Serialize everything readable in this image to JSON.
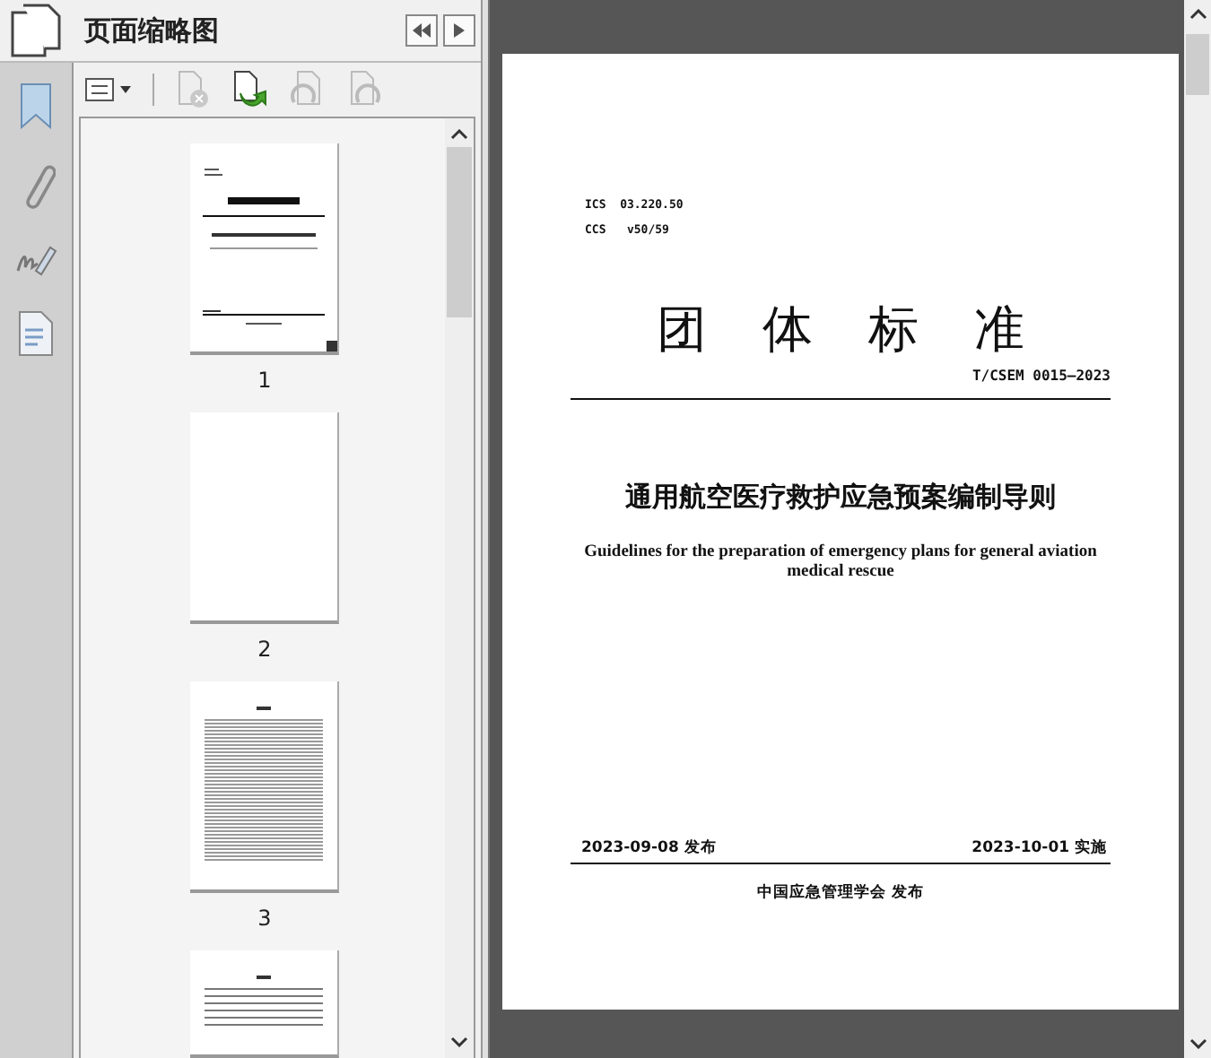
{
  "panel": {
    "title": "页面缩略图"
  },
  "thumbnails": [
    {
      "label": "1",
      "selected": true,
      "kind": "cover"
    },
    {
      "label": "2",
      "selected": false,
      "kind": "blank"
    },
    {
      "label": "3",
      "selected": false,
      "kind": "contents"
    },
    {
      "selected": false,
      "kind": "text"
    }
  ],
  "document": {
    "ics": "ICS  03.220.50",
    "ccs": "CCS   v50/59",
    "heading": "团 体 标 准",
    "code": "T/CSEM 0015—2023",
    "title_cn": "通用航空医疗救护应急预案编制导则",
    "title_en": "Guidelines for the preparation of emergency plans for general aviation medical rescue",
    "publish_date": "2023-09-08 发布",
    "effective_date": "2023-10-01 实施",
    "publisher": "中国应急管理学会 发布"
  }
}
